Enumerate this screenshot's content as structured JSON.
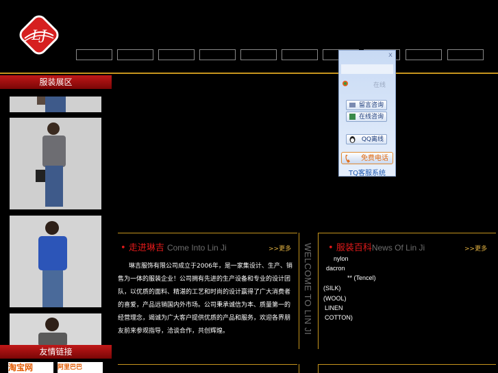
{
  "header": {
    "logo": {
      "text": "LJ",
      "colors": {
        "ring": "#d62020",
        "fill": "#ffffff"
      }
    },
    "nav_item_count": 10
  },
  "left": {
    "showroom_title": "服装展区",
    "links_title": "友情链接",
    "link_logos": [
      {
        "name": "taobao",
        "label": "淘宝网"
      },
      {
        "name": "alibaba",
        "label": "阿里巴巴"
      }
    ]
  },
  "intro": {
    "title_cn": "走进琳吉",
    "title_en": "Come Into Lin Ji",
    "more": ">>更多",
    "text": "琳吉服饰有限公司成立于2006年，是一家集设计、生产、销售为一体的服装企业！公司拥有先进的生产设备和专业的设计团队，以优质的面料、精湛的工艺和时尚的设计赢得了广大消费者的喜爱，产品远销国内外市场。公司秉承诚信为本、质量第一的经营理念，竭诚为广大客户提供优质的产品和服务，欢迎各界朋友前来参观指导，洽谈合作，共创辉煌。",
    "vertical_text": "WELCOME TO LIN JI"
  },
  "fabric": {
    "title_cn": "服装百科",
    "title_en": "News Of Lin Ji",
    "more": ">>更多",
    "items": [
      "nylon",
      "dacron",
      "** (Tencel)",
      "(SILK)",
      "(WOOL)",
      "LINEN",
      "COTTON)"
    ]
  },
  "tq_widget": {
    "close": "x",
    "status": "在线",
    "message_btn": "留言咨询",
    "online_btn": "在线咨询",
    "qq_btn": "QQ离线",
    "phone_btn": "免费电话",
    "footer": "TQ客服系统"
  },
  "colors": {
    "accent_gold": "#c8961e",
    "title_red": "#e31a1a",
    "bar_red": "#b01010"
  }
}
